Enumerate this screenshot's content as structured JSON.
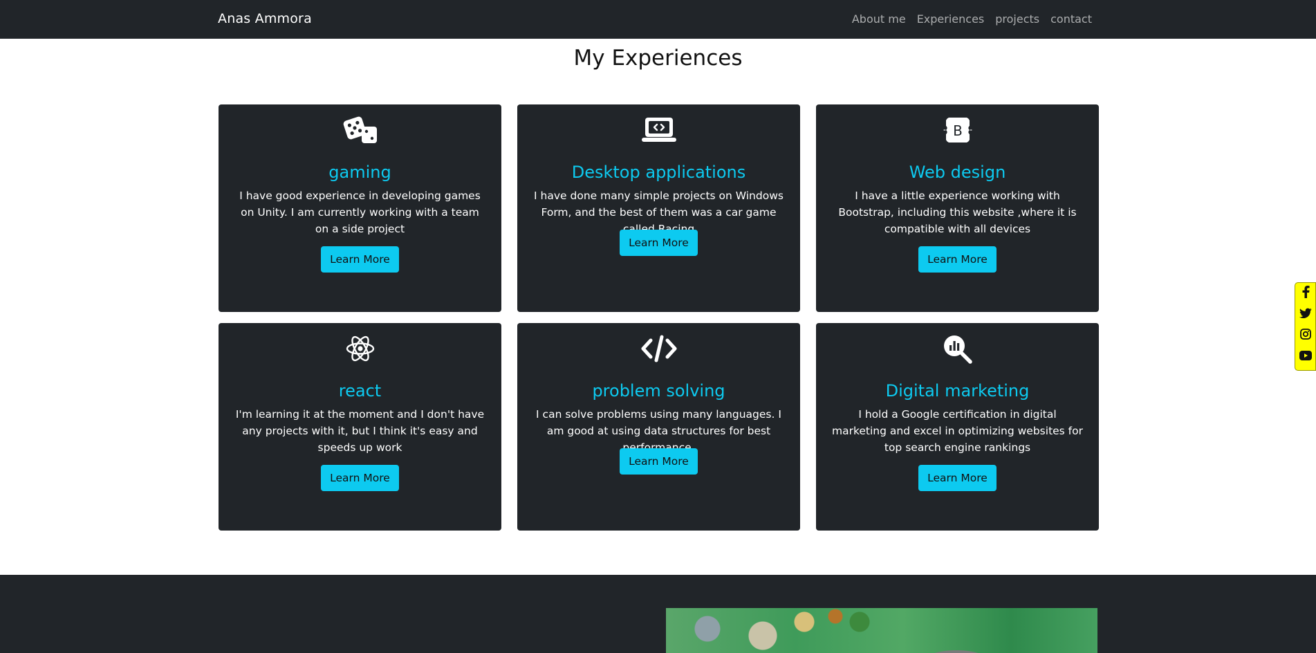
{
  "navbar": {
    "brand": "Anas Ammora",
    "links": [
      "About me",
      "Experiences",
      "projects",
      "contact"
    ]
  },
  "experiences": {
    "title": "My Experiences",
    "cards": [
      {
        "icon": "dice-icon",
        "title": "gaming",
        "text": "I have good experience in developing games on Unity. I am currently working with a team on a side project",
        "button": "Learn More"
      },
      {
        "icon": "laptop-code-icon",
        "title": "Desktop applications",
        "text": "I have done many simple projects on Windows Form, and the best of them was a car game called Racing",
        "button": "Learn More"
      },
      {
        "icon": "bootstrap-icon",
        "title": "Web design",
        "text": "I have a little experience working with Bootstrap, including this website ,where it is compatible with all devices",
        "button": "Learn More"
      },
      {
        "icon": "react-icon",
        "title": "react",
        "text": "I'm learning it at the moment and I don't have any projects with it, but I think it's easy and speeds up work",
        "button": "Learn More"
      },
      {
        "icon": "code-icon",
        "title": "problem solving",
        "text": "I can solve problems using many languages. I am good at using data structures for best performance.",
        "button": "Learn More"
      },
      {
        "icon": "magnifier-chart-icon",
        "title": "Digital marketing",
        "text": "I hold a Google certification in digital marketing and excel in optimizing websites for top search engine rankings",
        "button": "Learn More"
      }
    ]
  },
  "social": [
    "facebook-icon",
    "twitter-icon",
    "instagram-icon",
    "youtube-icon"
  ],
  "colors": {
    "dark": "#212529",
    "accent": "#0dcaf0",
    "social_bg": "#ffff00"
  }
}
